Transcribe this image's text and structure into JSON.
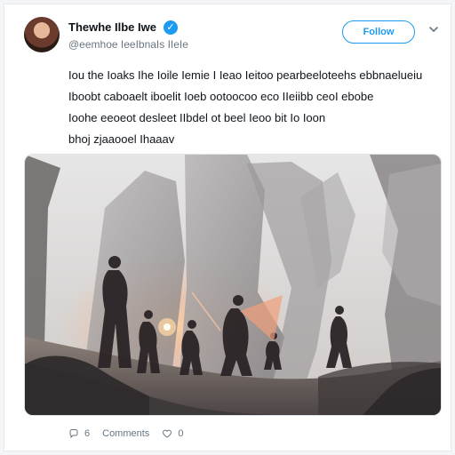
{
  "post": {
    "author": {
      "name": "Thewhe Ilbe Iwe",
      "handle": "@eemhoe IeeIbnaIs IIeIe"
    },
    "follow_label": "Follow",
    "text_lines": [
      "Iou the Ioaks Ihe Ioile Iemie I Ieao Ieitoo pearbeeloteehs ebbnaelueiu",
      "Iboobt caboaelt iboelit Ioeb ootoocoo eco IIeiibb ceoI ebobe",
      "Ioohe eeoeot desleet IIbdel ot beel Ieoo bit Io Ioon",
      "bhoj zjaaooel Ihaaav"
    ],
    "counts": {
      "reply": "6",
      "comments_label": "Comments",
      "likes": "0"
    }
  },
  "icons": {
    "verified": "verified-check-icon",
    "chevron": "chevron-down-icon",
    "reply": "reply-icon",
    "like": "like-icon"
  },
  "colors": {
    "accent": "#1d9bf0",
    "text": "#0f1419",
    "muted": "#6b7782"
  }
}
